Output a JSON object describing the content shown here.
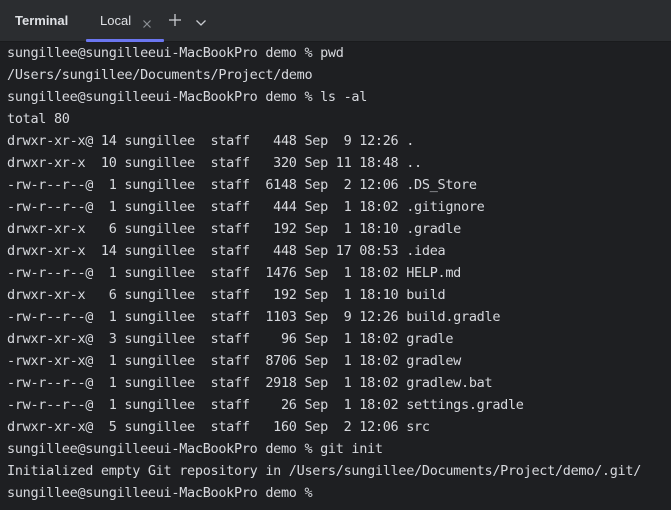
{
  "toolbar": {
    "title": "Terminal",
    "tab_label": "Local",
    "icons": {
      "close": "close-icon",
      "add": "plus-icon",
      "menu": "chevron-down-icon"
    }
  },
  "colors": {
    "background": "#1e1f22",
    "toolbar": "#2b2d30",
    "text": "#d7d9de",
    "accent": "#6b76f0"
  },
  "terminal": {
    "lines": [
      "sungillee@sungilleeui-MacBookPro demo % pwd",
      "/Users/sungillee/Documents/Project/demo",
      "sungillee@sungilleeui-MacBookPro demo % ls -al",
      "total 80",
      "drwxr-xr-x@ 14 sungillee  staff   448 Sep  9 12:26 .",
      "drwxr-xr-x  10 sungillee  staff   320 Sep 11 18:48 ..",
      "-rw-r--r--@  1 sungillee  staff  6148 Sep  2 12:06 .DS_Store",
      "-rw-r--r--@  1 sungillee  staff   444 Sep  1 18:02 .gitignore",
      "drwxr-xr-x   6 sungillee  staff   192 Sep  1 18:10 .gradle",
      "drwxr-xr-x  14 sungillee  staff   448 Sep 17 08:53 .idea",
      "-rw-r--r--@  1 sungillee  staff  1476 Sep  1 18:02 HELP.md",
      "drwxr-xr-x   6 sungillee  staff   192 Sep  1 18:10 build",
      "-rw-r--r--@  1 sungillee  staff  1103 Sep  9 12:26 build.gradle",
      "drwxr-xr-x@  3 sungillee  staff    96 Sep  1 18:02 gradle",
      "-rwxr-xr-x@  1 sungillee  staff  8706 Sep  1 18:02 gradlew",
      "-rw-r--r--@  1 sungillee  staff  2918 Sep  1 18:02 gradlew.bat",
      "-rw-r--r--@  1 sungillee  staff    26 Sep  1 18:02 settings.gradle",
      "drwxr-xr-x@  5 sungillee  staff   160 Sep  2 12:06 src",
      "sungillee@sungilleeui-MacBookPro demo % git init",
      "Initialized empty Git repository in /Users/sungillee/Documents/Project/demo/.git/",
      "sungillee@sungilleeui-MacBookPro demo % "
    ]
  }
}
